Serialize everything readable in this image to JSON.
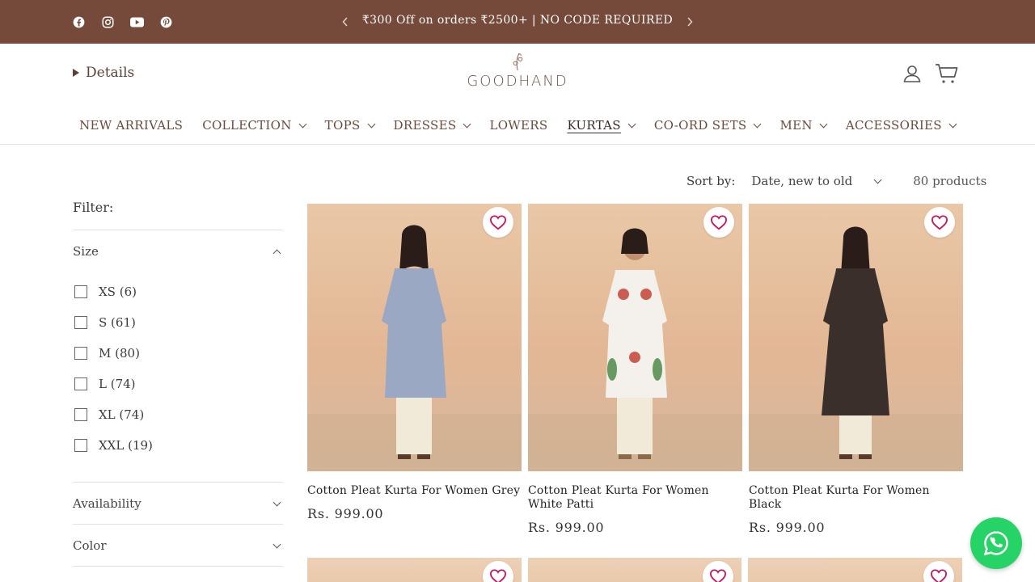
{
  "announcement": {
    "text": "₹300 Off on orders ₹2500+ | NO CODE REQUIRED",
    "social_icons": [
      "facebook-icon",
      "instagram-icon",
      "youtube-icon",
      "pinterest-icon"
    ]
  },
  "header": {
    "details_label": "Details",
    "logo_text": "GOODHAND",
    "nav": [
      {
        "label": "NEW ARRIVALS",
        "dropdown": false
      },
      {
        "label": "COLLECTION",
        "dropdown": true
      },
      {
        "label": "TOPS",
        "dropdown": true
      },
      {
        "label": "DRESSES",
        "dropdown": true
      },
      {
        "label": "LOWERS",
        "dropdown": false
      },
      {
        "label": "KURTAS",
        "dropdown": true,
        "active": true
      },
      {
        "label": "CO-ORD SETS",
        "dropdown": true
      },
      {
        "label": "MEN",
        "dropdown": true
      },
      {
        "label": "ACCESSORIES",
        "dropdown": true
      }
    ]
  },
  "sort": {
    "label": "Sort by:",
    "value": "Date, new to old",
    "count": "80 products"
  },
  "filter": {
    "title": "Filter:",
    "size": {
      "label": "Size",
      "options": [
        "XS (6)",
        "S (61)",
        "M (80)",
        "L (74)",
        "XL (74)",
        "XXL (19)"
      ]
    },
    "availability_label": "Availability",
    "color_label": "Color"
  },
  "products": [
    {
      "title": "Cotton Pleat Kurta For Women Grey",
      "price": "Rs. 999.00",
      "kurta_color": "#9aa8c4"
    },
    {
      "title": "Cotton Pleat Kurta For Women White Patti",
      "price": "Rs. 999.00",
      "kurta_color": "#f4f1ec"
    },
    {
      "title": "Cotton Pleat Kurta For Women Black",
      "price": "Rs. 999.00",
      "kurta_color": "#3a2f2b"
    }
  ],
  "colors": {
    "announcement_bg": "#764a3a",
    "wishlist_heart": "#c2185b",
    "whatsapp": "#25d366"
  }
}
